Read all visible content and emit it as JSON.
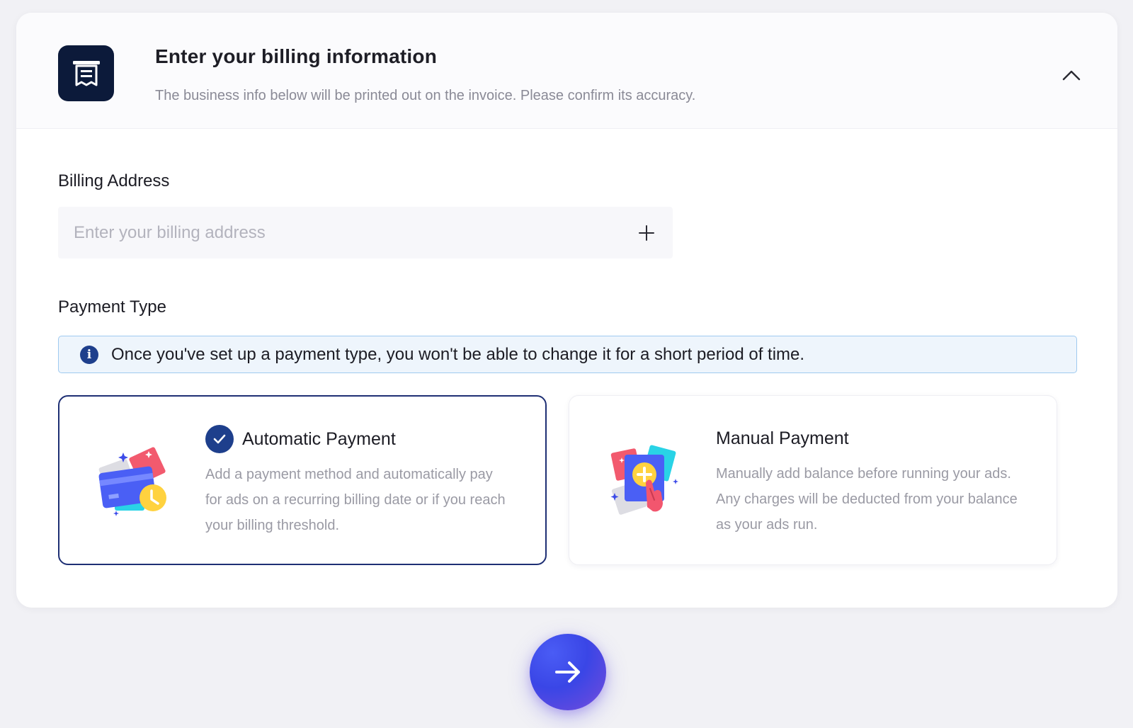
{
  "header": {
    "title": "Enter your billing information",
    "subtitle": "The business info below will be printed out on the invoice. Please confirm its accuracy."
  },
  "billing_address": {
    "label": "Billing Address",
    "placeholder": "Enter your billing address",
    "value": ""
  },
  "payment_type": {
    "label": "Payment Type",
    "info": "Once you've set up a payment type, you won't be able to change it for a short period of time.",
    "options": [
      {
        "title": "Automatic Payment",
        "description": "Add a payment method and automatically pay for ads on a recurring billing date or if you reach your billing threshold.",
        "selected": true
      },
      {
        "title": "Manual Payment",
        "description": "Manually add balance before running your ads. Any charges will be deducted from your balance as your ads run.",
        "selected": false
      }
    ]
  },
  "colors": {
    "accent": "#1e3f8c",
    "selected_border": "#1e2f74",
    "info_border": "#9fcaf0",
    "info_bg": "#eef5fc"
  },
  "icons": {
    "header": "invoice-icon",
    "collapse": "chevron-up-icon",
    "add": "plus-icon",
    "info": "info-icon",
    "check": "check-icon",
    "next": "arrow-right-icon"
  }
}
